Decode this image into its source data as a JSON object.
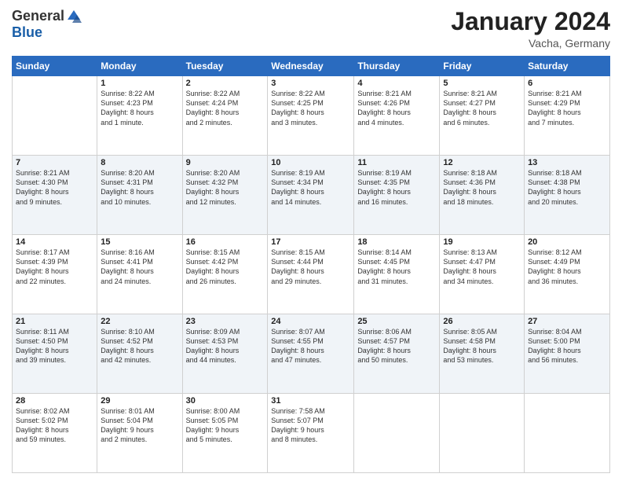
{
  "header": {
    "logo_general": "General",
    "logo_blue": "Blue",
    "month_title": "January 2024",
    "location": "Vacha, Germany"
  },
  "days_of_week": [
    "Sunday",
    "Monday",
    "Tuesday",
    "Wednesday",
    "Thursday",
    "Friday",
    "Saturday"
  ],
  "weeks": [
    [
      {
        "day": "",
        "info": ""
      },
      {
        "day": "1",
        "info": "Sunrise: 8:22 AM\nSunset: 4:23 PM\nDaylight: 8 hours\nand 1 minute."
      },
      {
        "day": "2",
        "info": "Sunrise: 8:22 AM\nSunset: 4:24 PM\nDaylight: 8 hours\nand 2 minutes."
      },
      {
        "day": "3",
        "info": "Sunrise: 8:22 AM\nSunset: 4:25 PM\nDaylight: 8 hours\nand 3 minutes."
      },
      {
        "day": "4",
        "info": "Sunrise: 8:21 AM\nSunset: 4:26 PM\nDaylight: 8 hours\nand 4 minutes."
      },
      {
        "day": "5",
        "info": "Sunrise: 8:21 AM\nSunset: 4:27 PM\nDaylight: 8 hours\nand 6 minutes."
      },
      {
        "day": "6",
        "info": "Sunrise: 8:21 AM\nSunset: 4:29 PM\nDaylight: 8 hours\nand 7 minutes."
      }
    ],
    [
      {
        "day": "7",
        "info": "Sunrise: 8:21 AM\nSunset: 4:30 PM\nDaylight: 8 hours\nand 9 minutes."
      },
      {
        "day": "8",
        "info": "Sunrise: 8:20 AM\nSunset: 4:31 PM\nDaylight: 8 hours\nand 10 minutes."
      },
      {
        "day": "9",
        "info": "Sunrise: 8:20 AM\nSunset: 4:32 PM\nDaylight: 8 hours\nand 12 minutes."
      },
      {
        "day": "10",
        "info": "Sunrise: 8:19 AM\nSunset: 4:34 PM\nDaylight: 8 hours\nand 14 minutes."
      },
      {
        "day": "11",
        "info": "Sunrise: 8:19 AM\nSunset: 4:35 PM\nDaylight: 8 hours\nand 16 minutes."
      },
      {
        "day": "12",
        "info": "Sunrise: 8:18 AM\nSunset: 4:36 PM\nDaylight: 8 hours\nand 18 minutes."
      },
      {
        "day": "13",
        "info": "Sunrise: 8:18 AM\nSunset: 4:38 PM\nDaylight: 8 hours\nand 20 minutes."
      }
    ],
    [
      {
        "day": "14",
        "info": "Sunrise: 8:17 AM\nSunset: 4:39 PM\nDaylight: 8 hours\nand 22 minutes."
      },
      {
        "day": "15",
        "info": "Sunrise: 8:16 AM\nSunset: 4:41 PM\nDaylight: 8 hours\nand 24 minutes."
      },
      {
        "day": "16",
        "info": "Sunrise: 8:15 AM\nSunset: 4:42 PM\nDaylight: 8 hours\nand 26 minutes."
      },
      {
        "day": "17",
        "info": "Sunrise: 8:15 AM\nSunset: 4:44 PM\nDaylight: 8 hours\nand 29 minutes."
      },
      {
        "day": "18",
        "info": "Sunrise: 8:14 AM\nSunset: 4:45 PM\nDaylight: 8 hours\nand 31 minutes."
      },
      {
        "day": "19",
        "info": "Sunrise: 8:13 AM\nSunset: 4:47 PM\nDaylight: 8 hours\nand 34 minutes."
      },
      {
        "day": "20",
        "info": "Sunrise: 8:12 AM\nSunset: 4:49 PM\nDaylight: 8 hours\nand 36 minutes."
      }
    ],
    [
      {
        "day": "21",
        "info": "Sunrise: 8:11 AM\nSunset: 4:50 PM\nDaylight: 8 hours\nand 39 minutes."
      },
      {
        "day": "22",
        "info": "Sunrise: 8:10 AM\nSunset: 4:52 PM\nDaylight: 8 hours\nand 42 minutes."
      },
      {
        "day": "23",
        "info": "Sunrise: 8:09 AM\nSunset: 4:53 PM\nDaylight: 8 hours\nand 44 minutes."
      },
      {
        "day": "24",
        "info": "Sunrise: 8:07 AM\nSunset: 4:55 PM\nDaylight: 8 hours\nand 47 minutes."
      },
      {
        "day": "25",
        "info": "Sunrise: 8:06 AM\nSunset: 4:57 PM\nDaylight: 8 hours\nand 50 minutes."
      },
      {
        "day": "26",
        "info": "Sunrise: 8:05 AM\nSunset: 4:58 PM\nDaylight: 8 hours\nand 53 minutes."
      },
      {
        "day": "27",
        "info": "Sunrise: 8:04 AM\nSunset: 5:00 PM\nDaylight: 8 hours\nand 56 minutes."
      }
    ],
    [
      {
        "day": "28",
        "info": "Sunrise: 8:02 AM\nSunset: 5:02 PM\nDaylight: 8 hours\nand 59 minutes."
      },
      {
        "day": "29",
        "info": "Sunrise: 8:01 AM\nSunset: 5:04 PM\nDaylight: 9 hours\nand 2 minutes."
      },
      {
        "day": "30",
        "info": "Sunrise: 8:00 AM\nSunset: 5:05 PM\nDaylight: 9 hours\nand 5 minutes."
      },
      {
        "day": "31",
        "info": "Sunrise: 7:58 AM\nSunset: 5:07 PM\nDaylight: 9 hours\nand 8 minutes."
      },
      {
        "day": "",
        "info": ""
      },
      {
        "day": "",
        "info": ""
      },
      {
        "day": "",
        "info": ""
      }
    ]
  ]
}
